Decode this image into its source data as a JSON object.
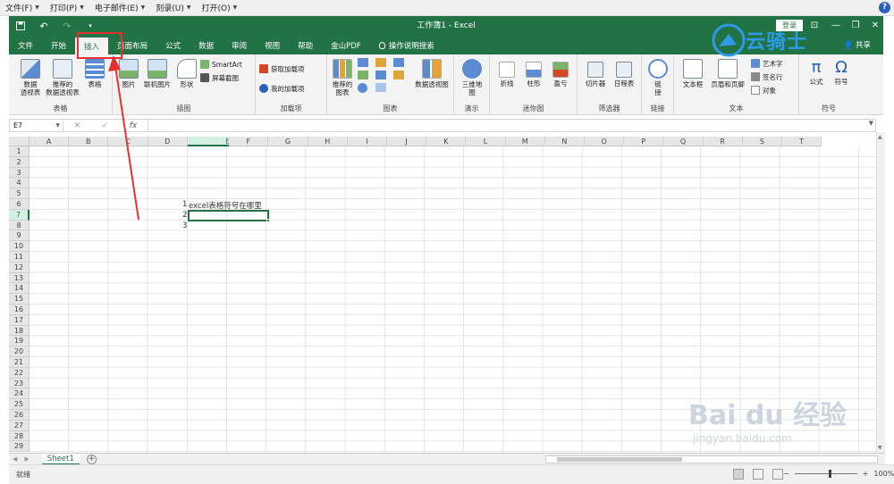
{
  "menubar": {
    "items": [
      "文件(F)",
      "打印(P)",
      "电子邮件(E)",
      "刻录(U)",
      "打开(O)"
    ],
    "help": "?"
  },
  "titlebar": {
    "title": "工作簿1  -  Excel",
    "login": "登录"
  },
  "tabs": [
    "文件",
    "开始",
    "插入",
    "页面布局",
    "公式",
    "数据",
    "审阅",
    "视图",
    "帮助",
    "金山PDF"
  ],
  "tell_me": "操作说明搜索",
  "share": "共享",
  "ribbon": {
    "groups": {
      "tables": {
        "label": "表格",
        "pivot": "数据\n透视表",
        "recommended_pivot": "推荐的\n数据透视表",
        "table": "表格"
      },
      "illustrations": {
        "label": "插图",
        "pictures": "图片",
        "online_pictures": "联机图片",
        "shapes": "形状",
        "smartart": "SmartArt",
        "screenshot": "屏幕截图"
      },
      "addins": {
        "label": "加载项",
        "get": "获取加载项",
        "my": "我的加载项"
      },
      "charts": {
        "label": "图表",
        "recommended": "推荐的\n图表",
        "pivot_chart": "数据透视图"
      },
      "tours": {
        "label": "演示",
        "map3d": "三维地\n图"
      },
      "sparklines": {
        "label": "迷你图",
        "line": "折线",
        "column": "柱形",
        "winloss": "盈亏"
      },
      "filters": {
        "label": "筛选器",
        "slicer": "切片器",
        "timeline": "日程表"
      },
      "links": {
        "label": "链接",
        "link": "链\n接"
      },
      "text": {
        "label": "文本",
        "textbox": "文本框",
        "header_footer": "页眉和页脚",
        "wordart": "艺术字",
        "signature": "签名行",
        "object": "对象"
      },
      "symbols": {
        "label": "符号",
        "equation": "公式",
        "symbol": "符号"
      }
    }
  },
  "formula_bar": {
    "name_box": "E7",
    "fx": "fx",
    "cancel": "✕",
    "enter": "✓",
    "content": ""
  },
  "grid": {
    "columns": [
      "A",
      "B",
      "C",
      "D",
      "E",
      "F",
      "G",
      "H",
      "I",
      "J",
      "K",
      "L",
      "M",
      "N",
      "O",
      "P",
      "Q",
      "R",
      "S",
      "T"
    ],
    "rows": [
      "1",
      "2",
      "3",
      "4",
      "5",
      "6",
      "7",
      "8",
      "9",
      "10",
      "11",
      "12",
      "13",
      "14",
      "15",
      "16",
      "17",
      "18",
      "19",
      "20",
      "21",
      "22",
      "23",
      "24",
      "25",
      "26",
      "27",
      "28",
      "29"
    ],
    "selected_cell": "E7",
    "cells": {
      "D6": "1",
      "E6": "excel表格符号在哪里",
      "D7": "2",
      "D8": "3"
    }
  },
  "sheets": [
    "Sheet1"
  ],
  "status": {
    "ready": "就绪",
    "zoom": "100%"
  },
  "logo": "云骑士",
  "watermark": {
    "line1": "Bai du 经验",
    "line2": "jingyan.baidu.com"
  },
  "colors": {
    "excel_green": "#217346",
    "annotation_red": "#e83030"
  }
}
